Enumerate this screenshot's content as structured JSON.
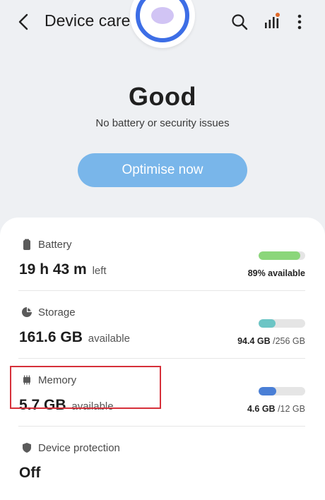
{
  "header": {
    "title": "Device care",
    "back_icon": "back-arrow-icon",
    "search_icon": "search-icon",
    "signal_icon": "signal-bars-icon",
    "more_icon": "more-vertical-icon",
    "notification_dot_color": "#e06a2a"
  },
  "hero": {
    "status": "Good",
    "substatus": "No battery or security issues",
    "optimise_label": "Optimise now",
    "accent_color": "#3d6ee6",
    "button_color": "#79b6ea"
  },
  "items": {
    "battery": {
      "label": "Battery",
      "value": "19 h 43 m",
      "unit": "left",
      "bar_text": "89% available",
      "fill_percent": 89,
      "fill_color": "#8bd67a",
      "icon": "battery-icon"
    },
    "storage": {
      "label": "Storage",
      "value": "161.6 GB",
      "unit": "available",
      "used": "94.4 GB",
      "total": "/256 GB",
      "fill_percent": 37,
      "fill_color": "#6cc5c5",
      "icon": "storage-pie-icon"
    },
    "memory": {
      "label": "Memory",
      "value": "5.7 GB",
      "unit": "available",
      "used": "4.6 GB",
      "total": "/12 GB",
      "fill_percent": 38,
      "fill_color": "#4a7fd6",
      "icon": "memory-chip-icon",
      "highlight_color": "#d6303a"
    },
    "protection": {
      "label": "Device protection",
      "value": "Off",
      "icon": "shield-icon"
    }
  }
}
